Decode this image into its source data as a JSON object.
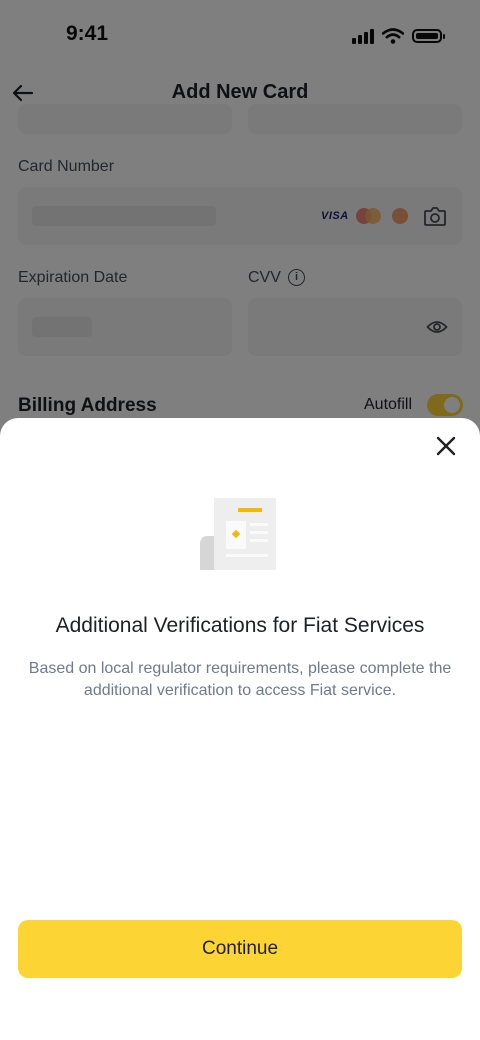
{
  "status_bar": {
    "time": "9:41"
  },
  "header": {
    "title": "Add New Card"
  },
  "form": {
    "card_number_label": "Card Number",
    "card_brand": "VISA",
    "expiration_label": "Expiration Date",
    "cvv_label": "CVV",
    "cvv_info_glyph": "i",
    "billing_address_label": "Billing Address",
    "autofill_label": "Autofill",
    "autofill_enabled": true
  },
  "modal": {
    "title": "Additional Verifications for Fiat Services",
    "description": "Based on local regulator requirements, please complete the additional verification to access Fiat service.",
    "continue_label": "Continue"
  },
  "colors": {
    "accent": "#FCD535",
    "text_primary": "#1E2026",
    "text_secondary": "#707A8A",
    "field_background": "#F5F5F5",
    "overlay": "rgba(0,0,0,0.5)"
  },
  "icons": {
    "back": "arrow-left-icon",
    "camera": "camera-icon",
    "eye": "eye-icon",
    "info": "info-icon",
    "close": "close-icon",
    "document": "document-illustration"
  }
}
